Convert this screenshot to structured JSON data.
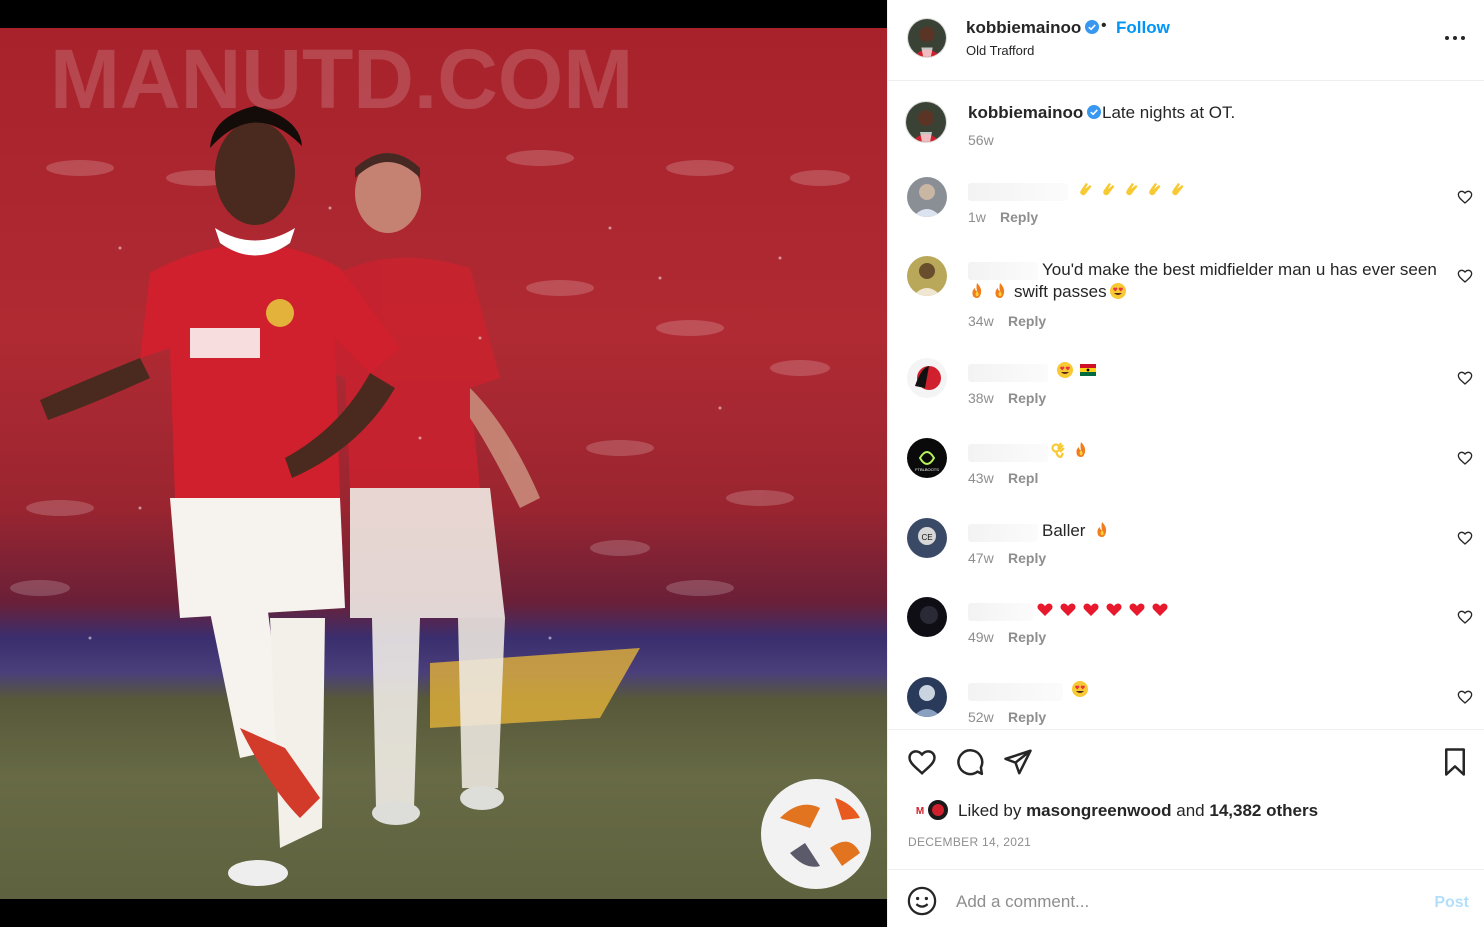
{
  "post": {
    "username": "kobbiemainoo",
    "follow_label": "Follow",
    "separator": "•",
    "location": "Old Trafford",
    "caption": "Late nights at OT.",
    "caption_time": "56w",
    "liked_by_prefix": "Liked by",
    "liked_by_user": "masongreenwood",
    "liked_by_joiner": "and",
    "liked_by_others": "14,382 others",
    "date": "DECEMBER 14, 2021"
  },
  "comments": [
    {
      "text": "",
      "emojis": [
        "clap-emoji",
        "clap-emoji",
        "clap-emoji",
        "clap-emoji",
        "clap-emoji"
      ],
      "time": "1w",
      "reply": "Reply"
    },
    {
      "text": "You'd make the best midfielder man u has ever seen",
      "line2": "swift passes",
      "time": "34w",
      "reply": "Reply"
    },
    {
      "text": "",
      "emojis": [
        "heart-eyes-emoji",
        "ghana-flag-emoji"
      ],
      "time": "38w",
      "reply": "Reply"
    },
    {
      "text": "",
      "emojis": [
        "ok-hand-emoji",
        "fire-emoji"
      ],
      "time": "43w",
      "reply": "Repl"
    },
    {
      "text": "Baller",
      "emojis": [
        "fire-emoji"
      ],
      "time": "47w",
      "reply": "Reply"
    },
    {
      "text": "",
      "emojis": [
        "red-heart-emoji",
        "red-heart-emoji",
        "red-heart-emoji",
        "red-heart-emoji",
        "red-heart-emoji",
        "red-heart-emoji"
      ],
      "time": "49w",
      "reply": "Reply"
    },
    {
      "text": "",
      "emojis": [
        "heart-eyes-emoji"
      ],
      "time": "52w",
      "reply": "Reply"
    }
  ],
  "composer": {
    "placeholder": "Add a comment...",
    "post_label": "Post"
  },
  "colors": {
    "accent": "#0095f6",
    "post_disabled": "#b2dffc",
    "kit_red": "#d0202d"
  },
  "icons": [
    "verified-icon",
    "more-options-icon",
    "heart-icon",
    "comment-icon",
    "share-icon",
    "save-icon",
    "emoji-icon"
  ]
}
